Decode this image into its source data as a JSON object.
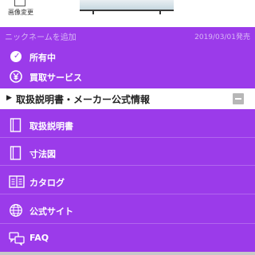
{
  "header": {
    "change_image_label": "画像変更",
    "nickname_placeholder": "ニックネームを追加",
    "release_date": "2019/03/01発売"
  },
  "status_items": [
    {
      "label": "所有中",
      "icon": "check-circle-icon"
    },
    {
      "label": "買取サービス",
      "icon": "yen-circle-icon"
    }
  ],
  "section": {
    "title": "取扱説明書・メーカー公式情報",
    "expand_icon": "triangle-right-icon",
    "collapse_icon": "minus-icon"
  },
  "section_items": [
    {
      "label": "取扱説明書",
      "icon": "manual-icon"
    },
    {
      "label": "寸法図",
      "icon": "dimension-icon"
    },
    {
      "label": "カタログ",
      "icon": "catalog-icon"
    },
    {
      "label": "公式サイト",
      "icon": "globe-icon"
    },
    {
      "label": "FAQ",
      "icon": "faq-icon"
    }
  ],
  "colors": {
    "background": "#9b3bea",
    "header_row": "#ffffff",
    "text": "#ffffff"
  }
}
